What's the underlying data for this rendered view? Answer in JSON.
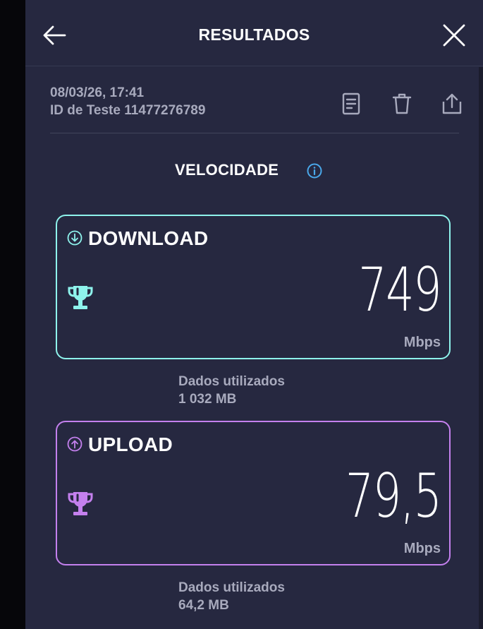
{
  "header": {
    "title": "RESULTADOS"
  },
  "meta": {
    "date": "08/03/26, 17:41",
    "test_id": "ID de Teste 11477276789"
  },
  "section": {
    "title": "VELOCIDADE"
  },
  "download": {
    "label": "DOWNLOAD",
    "value": "749",
    "unit": "Mbps",
    "data_label": "Dados utilizados",
    "data_value": "1 032 MB",
    "color": "#8ef3ec"
  },
  "upload": {
    "label": "UPLOAD",
    "value": "79,5",
    "unit": "Mbps",
    "data_label": "Dados utilizados",
    "data_value": "64,2 MB",
    "color": "#c480ee"
  },
  "icons": {
    "back": "arrow-left-icon",
    "close": "close-icon",
    "document": "document-icon",
    "delete": "trash-icon",
    "share": "share-icon",
    "info": "info-icon",
    "trophy": "trophy-icon"
  }
}
